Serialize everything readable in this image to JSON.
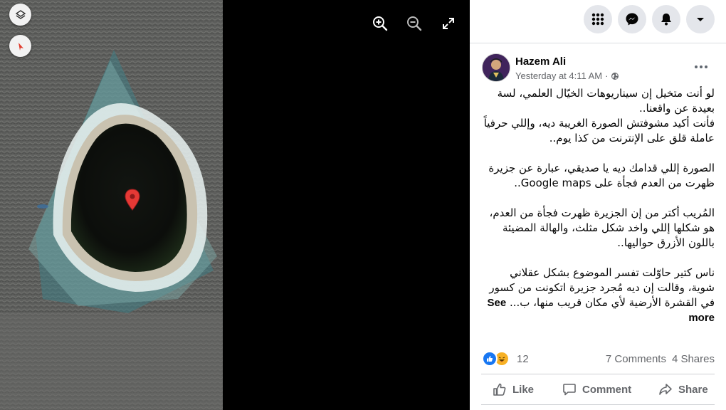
{
  "viewer": {
    "photo_description_icons": [
      "layers-icon",
      "compass-icon",
      "map-pin-icon"
    ],
    "tools": [
      "zoom-in-icon",
      "zoom-out-icon",
      "fullscreen-icon"
    ]
  },
  "topbar": {
    "buttons": [
      "menu-grid-icon",
      "messenger-icon",
      "notifications-icon",
      "account-dropdown-icon"
    ]
  },
  "post": {
    "author": "Hazem Ali",
    "timestamp": "Yesterday at 4:11 AM",
    "separator": "·",
    "privacy_icon": "globe-icon",
    "paragraph_1": "لو أنت متخيل إن سيناريوهات الخيّال العلمي، لسة بعيدة عن واقعنا..\nفأنت أكيد مشوفتش الصورة الغريبة ديه، وإللي حرفياً عاملة قلق على الإنترنت من كذا يوم..",
    "paragraph_2": "الصورة إللي قدامك ديه يا صديقي، عبارة عن جزيرة ظهرت من العدم فجأة على Google maps..",
    "paragraph_3": "المُريب أكتر من إن الجزيرة ظهرت فجأة من العدم، هو شكلها إللي واخد شكل مثلث، والهالة المضيئة باللون الأزرق حواليها..",
    "paragraph_4": "ناس كتير حاوّلت تفسر الموضوع بشكل عقلاني شوية، وقالت إن ديه مُجرد جزيرة اتكونت من كسور في القشرة الأرضية لأي مكان قريب منها، ب... ",
    "see_more": "See more",
    "reaction_count": "12",
    "comments": "7 Comments",
    "shares": "4 Shares",
    "actions": {
      "like": "Like",
      "comment": "Comment",
      "share": "Share"
    }
  },
  "colors": {
    "accent": "#1877f2",
    "text_secondary": "#65676b",
    "pin": "#e53935",
    "like_blue": "#1877f2",
    "haha_yellow": "#f7b125"
  }
}
